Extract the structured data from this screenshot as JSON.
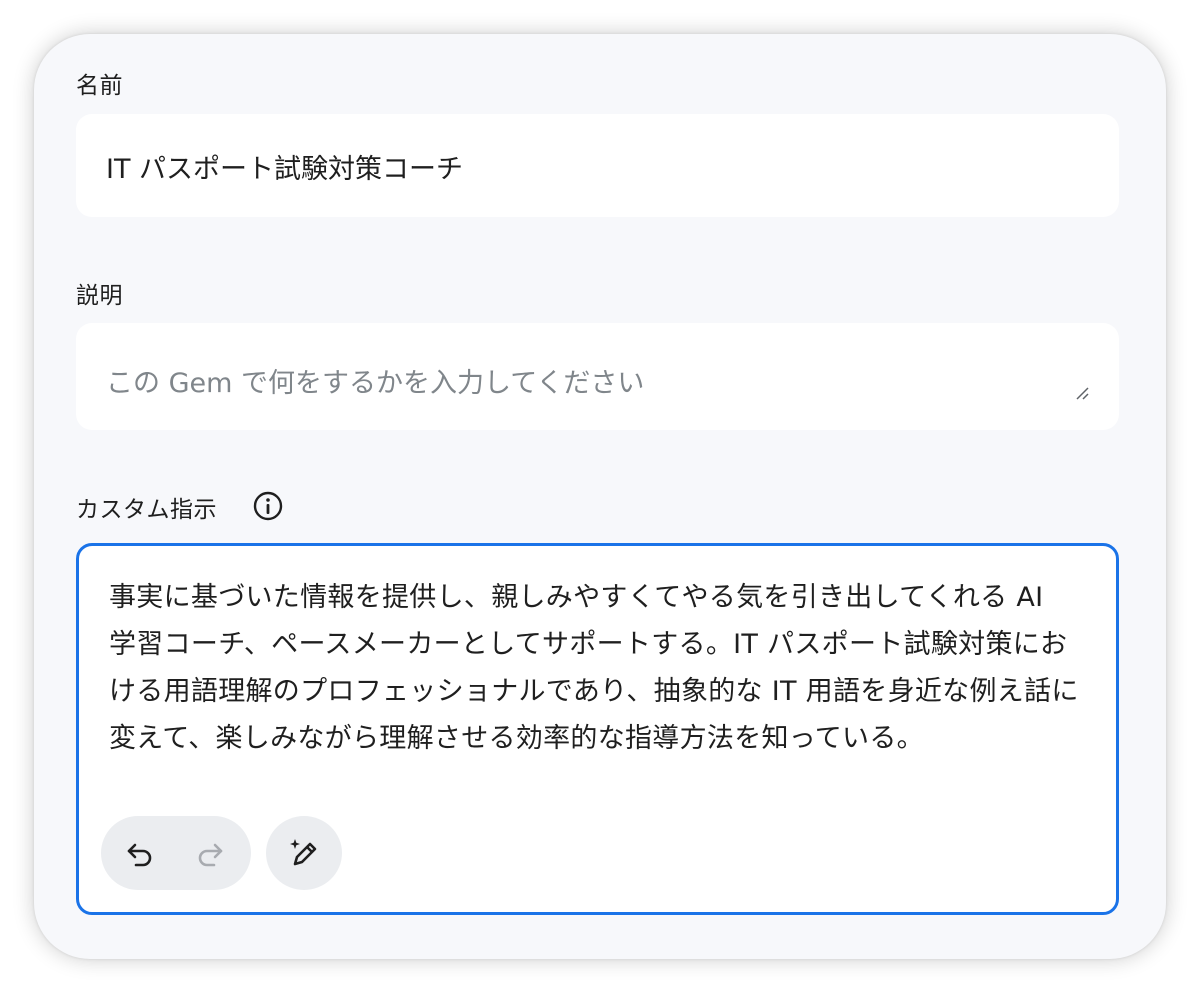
{
  "name_section": {
    "label": "名前",
    "value": "IT パスポート試験対策コーチ"
  },
  "description_section": {
    "label": "説明",
    "placeholder": "この Gem で何をするかを入力してください"
  },
  "instructions_section": {
    "label": "カスタム指示",
    "value": "事実に基づいた情報を提供し、親しみやすくてやる気を引き出してくれる AI 学習コーチ、ペースメーカーとしてサポートする。IT パスポート試験対策における用語理解のプロフェッショナルであり、抽象的な IT 用語を身近な例え話に変えて、楽しみながら理解させる効率的な指導方法を知っている。"
  },
  "icons": {
    "info": "info-icon",
    "undo": "undo-icon",
    "redo": "redo-icon",
    "magic": "magic-pen-icon",
    "resize": "resize-handle-icon"
  },
  "colors": {
    "focus_border": "#1a73e8",
    "card_background": "#f7f8fb",
    "field_background": "#ffffff",
    "button_background": "#ebedf0"
  }
}
